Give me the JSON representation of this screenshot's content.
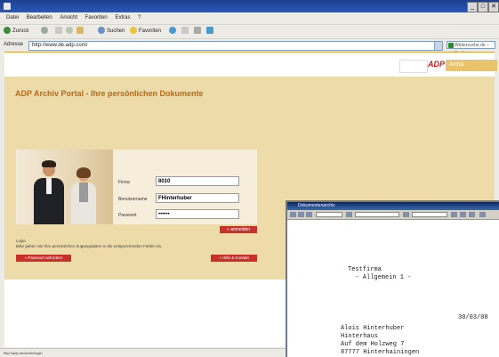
{
  "browser": {
    "title": "",
    "menu": [
      "Datei",
      "Bearbeiten",
      "Ansicht",
      "Favoriten",
      "Extras",
      "?"
    ],
    "toolbar": {
      "back": "Zurück",
      "suchen": "Suchen",
      "favoriten": "Favoriten"
    },
    "address_label": "Adresse",
    "address_value": "http://www.de.adp.com/",
    "search_placeholder": "Weitersuche.de – Suche",
    "status_text": "http://adp.de/archiv/login"
  },
  "portal": {
    "logo": "ADP",
    "logo_bar": "Archiv",
    "title": "ADP Archiv Portal - Ihre persönlichen Dokumente",
    "form": {
      "firma_label": "Firma",
      "firma_value": "8010",
      "benutzer_label": "Benutzername",
      "benutzer_value": "FHinterhuber",
      "passwort_label": "Passwort",
      "passwort_value": "••••••"
    },
    "anmelden": "» anmelden",
    "hint_line1": "Login",
    "hint_line2": "Bitte geben Sie Ihre persönlichen Zugangsdaten in die entsprechenden Felder ein.",
    "passwort_vergessen": "» Passwort anfordern",
    "hilfe": "» Hilfe & Kontakt"
  },
  "viewer": {
    "title": "Dokumentenarchiv",
    "lines": [
      "Testfirma",
      "  - Allgemein 1 -",
      "",
      "",
      "",
      "Alois Hinterhuber",
      "Hinterhaus",
      "Auf dem Holzweg 7",
      "87777 Hinterhainingen"
    ],
    "date": "30/03/08"
  },
  "colors": {
    "accent": "#b86a16",
    "panel": "#eedbaa",
    "button": "#c8302a",
    "logo_red": "#d4161b"
  }
}
